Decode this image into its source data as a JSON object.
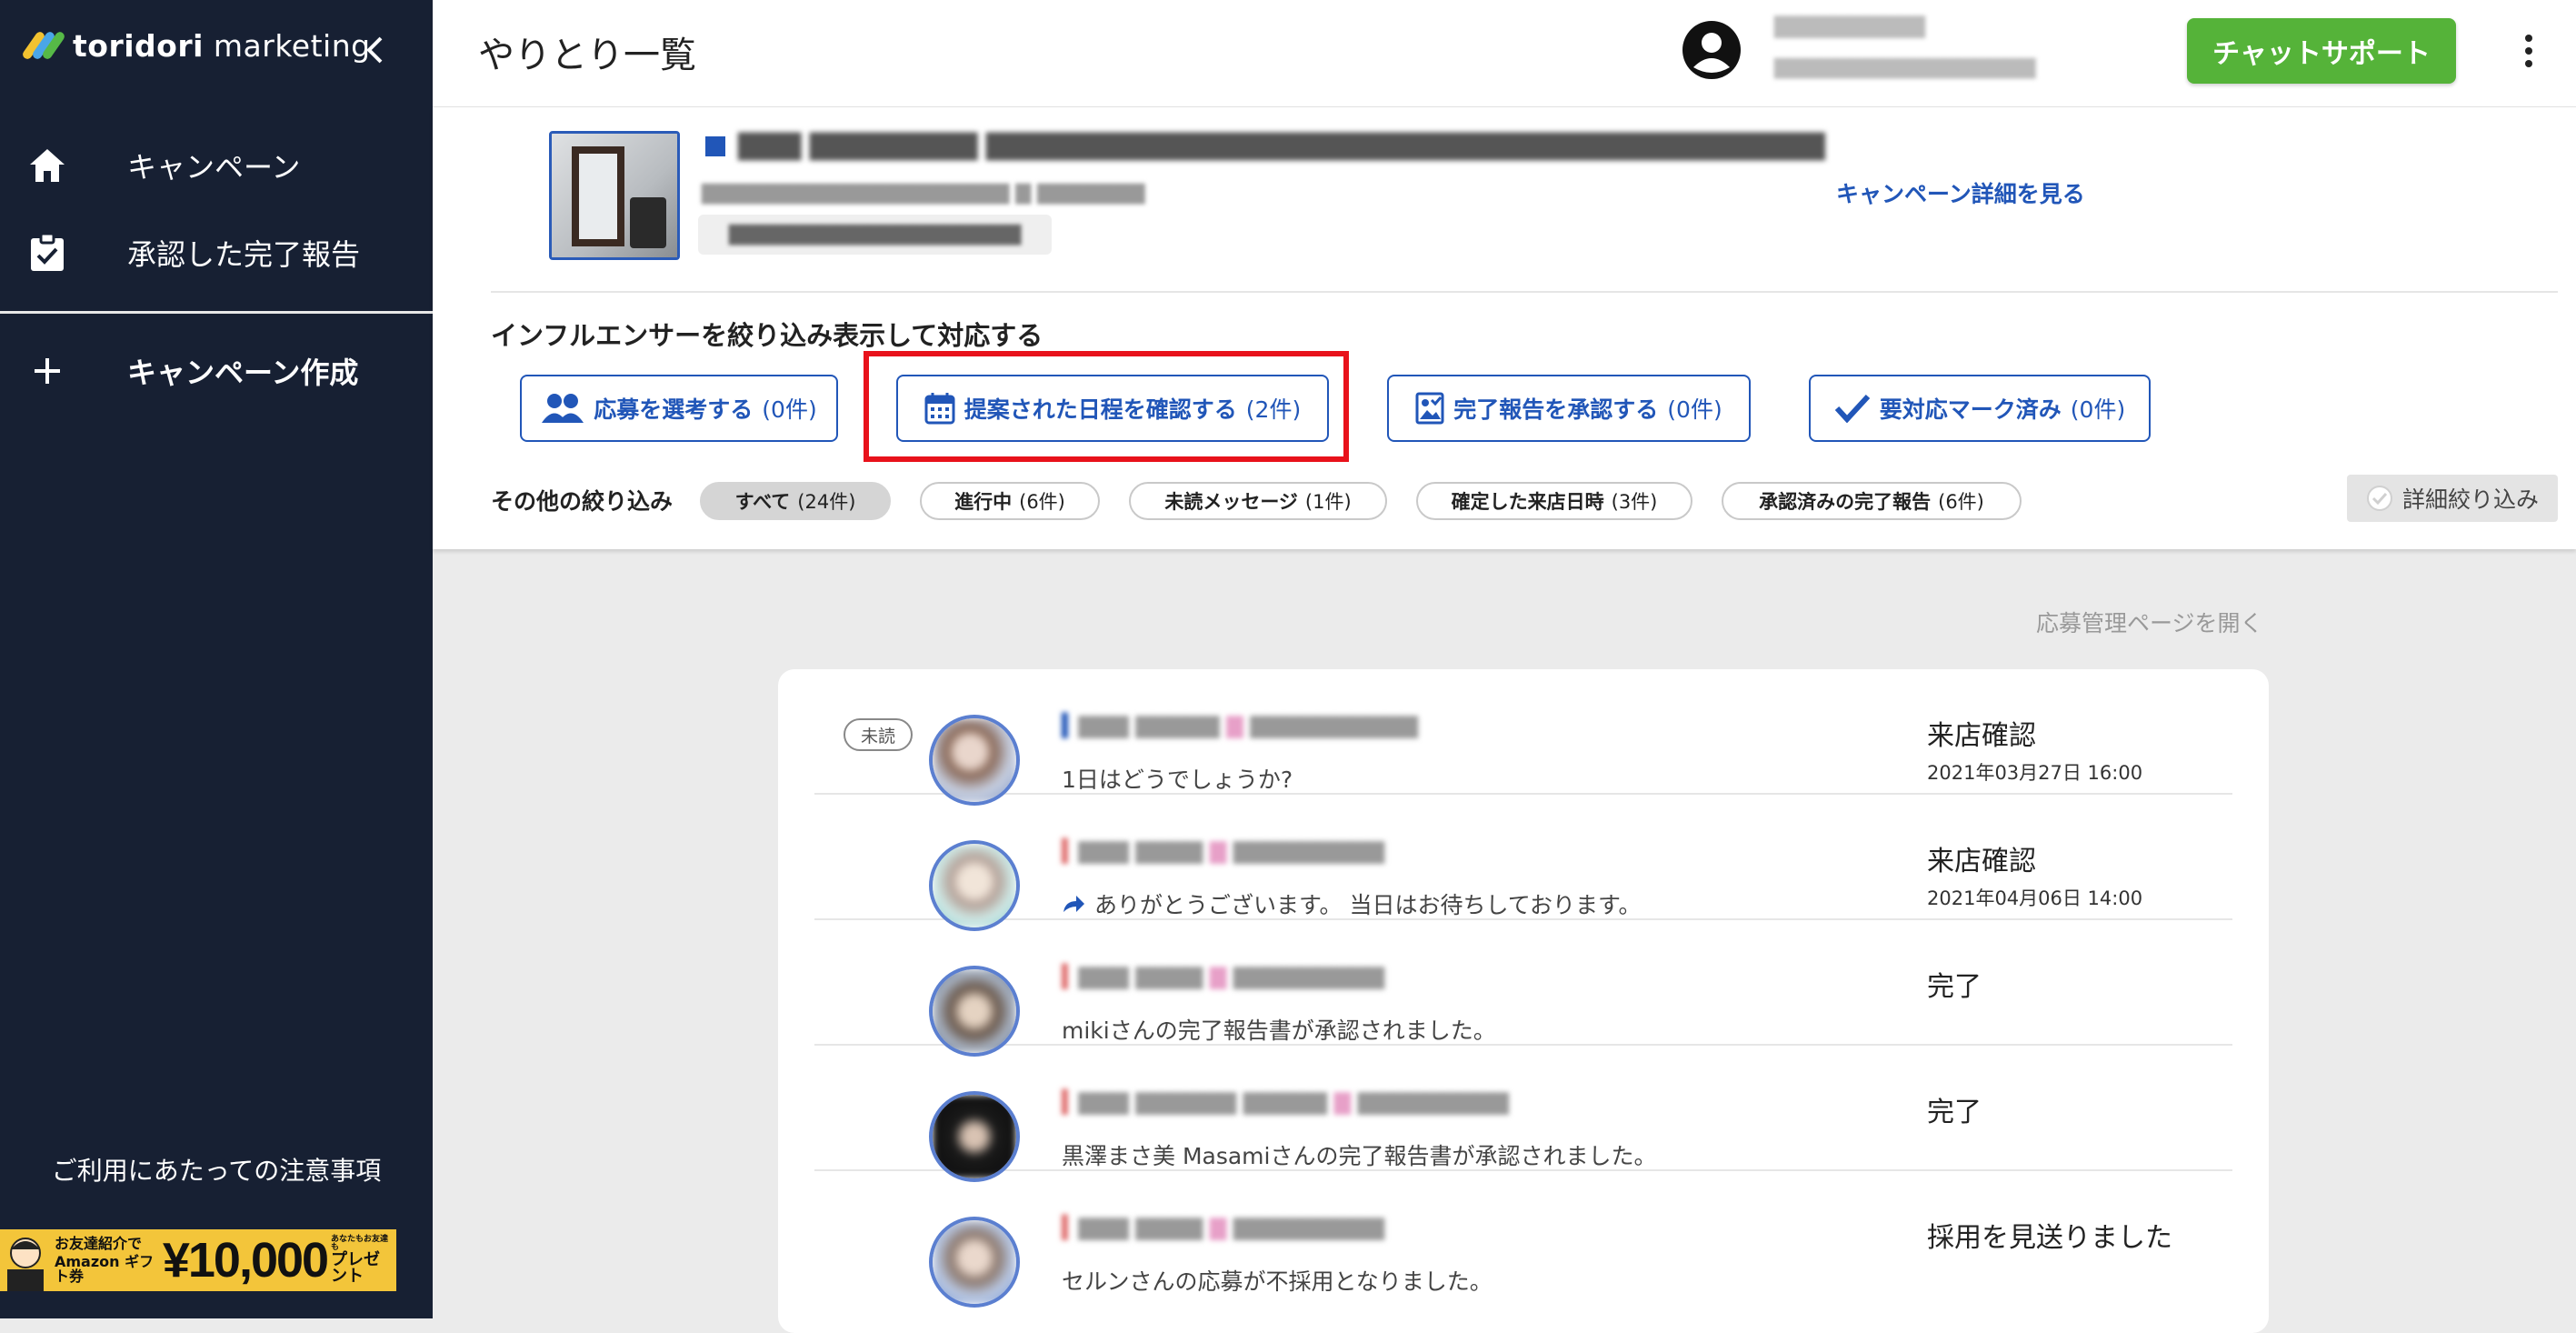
{
  "sidebar": {
    "logo_bold": "toridori",
    "logo_light": " marketing",
    "nav": [
      {
        "label": "キャンペーン"
      },
      {
        "label": "承認した完了報告"
      },
      {
        "label": "キャンペーン作成"
      }
    ],
    "notice": "ご利用にあたっての注意事項",
    "banner": {
      "small_top": "お友達紹介で",
      "small_bottom": "Amazon ギフト券",
      "amount": "¥10,000",
      "suffix": "プレゼント",
      "tiny": "あなたもお友達も"
    }
  },
  "header": {
    "title": "やりとり一覧",
    "chat_button": "チャットサポート"
  },
  "campaign": {
    "detail_link": "キャンペーン詳細を見る"
  },
  "filters": {
    "heading": "インフルエンサーを絞り込み表示して対応する",
    "quick": [
      {
        "label": "応募を選考する",
        "count": "(0件)"
      },
      {
        "label": "提案された日程を確認する",
        "count": "(2件)"
      },
      {
        "label": "完了報告を承認する",
        "count": "(0件)"
      },
      {
        "label": "要対応マーク済み",
        "count": "(0件)"
      }
    ],
    "other_label": "その他の絞り込み",
    "chips": [
      {
        "label": "すべて",
        "count": "(24件)"
      },
      {
        "label": "進行中",
        "count": "(6件)"
      },
      {
        "label": "未読メッセージ",
        "count": "(1件)"
      },
      {
        "label": "確定した来店日時",
        "count": "(3件)"
      },
      {
        "label": "承認済みの完了報告",
        "count": "(6件)"
      }
    ],
    "detail_filter": "詳細絞り込み"
  },
  "manage_link": "応募管理ページを開く",
  "threads": [
    {
      "badge": "未読",
      "message": "1日はどうでしょうか?",
      "status": "来店確認",
      "date": "2021年03月27日 16:00"
    },
    {
      "badge": "",
      "message": "ありがとうございます。 当日はお待ちしております。",
      "status": "来店確認",
      "date": "2021年04月06日 14:00"
    },
    {
      "badge": "",
      "message": "mikiさんの完了報告書が承認されました。",
      "status": "完了",
      "date": ""
    },
    {
      "badge": "",
      "message": "黒澤まさ美 Masamiさんの完了報告書が承認されました。",
      "status": "完了",
      "date": ""
    },
    {
      "badge": "",
      "message": "セルンさんの応募が不採用となりました。",
      "status": "採用を見送りました",
      "date": ""
    }
  ],
  "colors": {
    "sidebar_bg": "#172033",
    "accent_blue": "#2156b8",
    "chat_green": "#55b339",
    "highlight_red": "#e8121b"
  }
}
